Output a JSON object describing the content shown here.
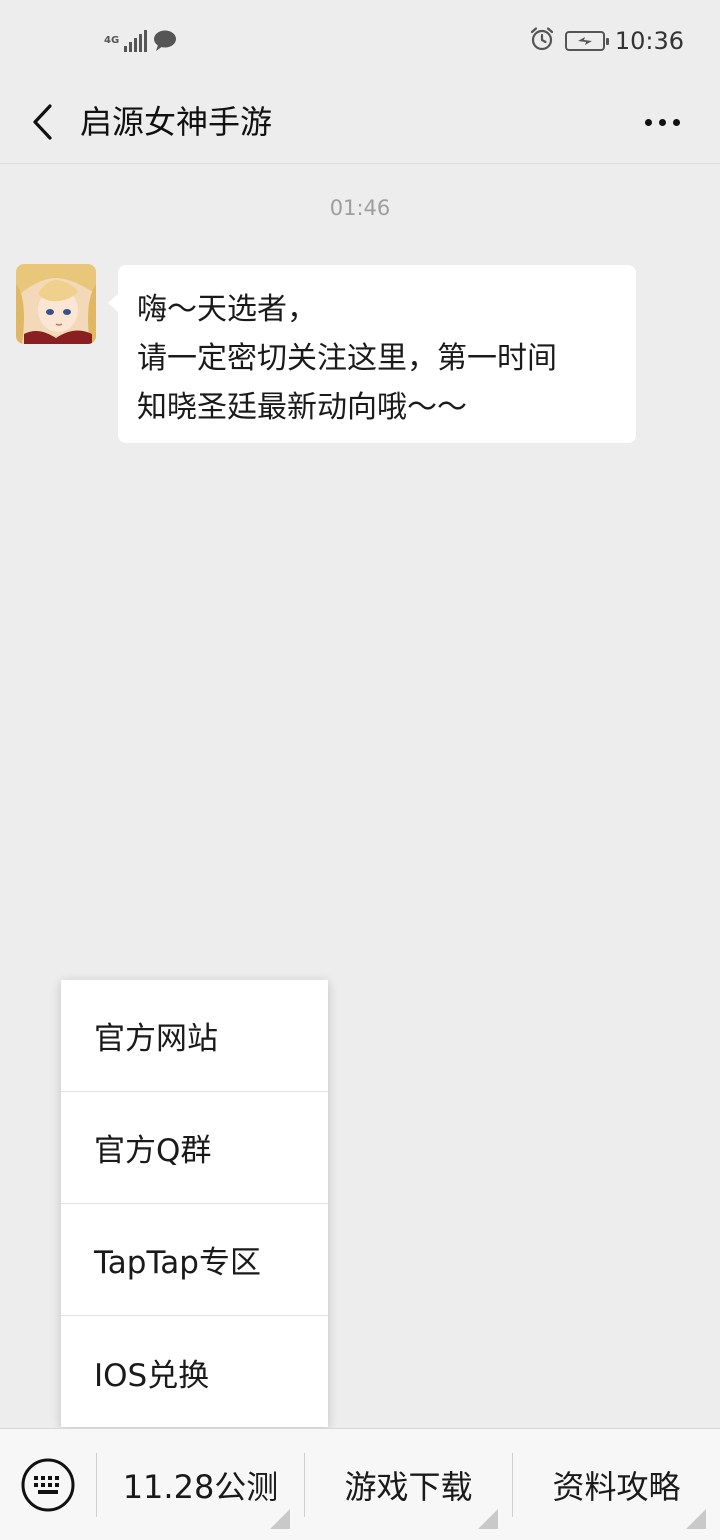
{
  "status_bar": {
    "network_label": "4G",
    "time": "10:36"
  },
  "header": {
    "title": "启源女神手游"
  },
  "chat": {
    "timestamp": "01:46",
    "message_lines": [
      "嗨～天选者，",
      "请一定密切关注这里，第一时间",
      "知晓圣廷最新动向哦～～"
    ]
  },
  "popup_menu": {
    "items": [
      "官方网站",
      "官方Q群",
      "TapTap专区",
      "IOS兑换"
    ]
  },
  "bottom_menu": {
    "tabs": [
      "11.28公测",
      "游戏下载",
      "资料攻略"
    ]
  },
  "colors": {
    "background": "#ededed",
    "bubble": "#ffffff",
    "timestamp_text": "#9e9e9e"
  }
}
